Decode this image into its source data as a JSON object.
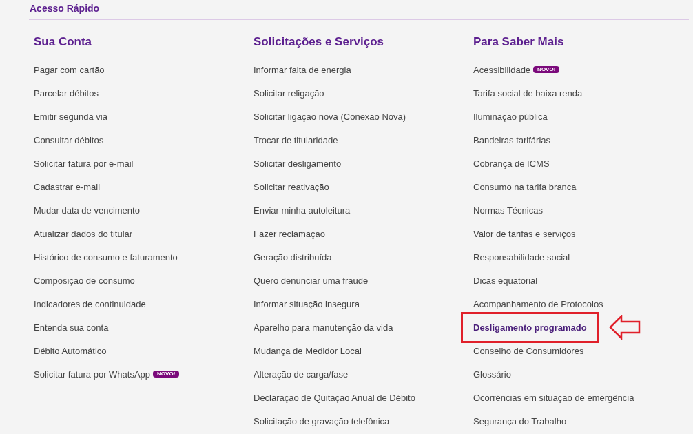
{
  "section_title": "Acesso Rápido",
  "columns": [
    {
      "heading": "Sua Conta",
      "items": [
        {
          "label": "Pagar com cartão",
          "highlighted": false
        },
        {
          "label": "Parcelar débitos",
          "highlighted": false
        },
        {
          "label": "Emitir segunda via",
          "highlighted": false
        },
        {
          "label": "Consultar débitos",
          "highlighted": false
        },
        {
          "label": "Solicitar fatura por e-mail",
          "highlighted": false
        },
        {
          "label": "Cadastrar e-mail",
          "highlighted": false
        },
        {
          "label": "Mudar data de vencimento",
          "highlighted": false
        },
        {
          "label": "Atualizar dados do titular",
          "highlighted": false
        },
        {
          "label": "Histórico de consumo e faturamento",
          "highlighted": false
        },
        {
          "label": "Composição de consumo",
          "highlighted": false
        },
        {
          "label": "Indicadores de continuidade",
          "highlighted": false
        },
        {
          "label": "Entenda sua conta",
          "highlighted": false
        },
        {
          "label": "Débito Automático",
          "highlighted": false
        },
        {
          "label": "Solicitar fatura por WhatsApp",
          "badge": "NOVO!",
          "highlighted": false
        }
      ]
    },
    {
      "heading": "Solicitações e Serviços",
      "items": [
        {
          "label": "Informar falta de energia",
          "highlighted": false
        },
        {
          "label": "Solicitar religação",
          "highlighted": false
        },
        {
          "label": "Solicitar ligação nova (Conexão Nova)",
          "highlighted": false
        },
        {
          "label": "Trocar de titularidade",
          "highlighted": false
        },
        {
          "label": "Solicitar desligamento",
          "highlighted": false
        },
        {
          "label": "Solicitar reativação",
          "highlighted": false
        },
        {
          "label": "Enviar minha autoleitura",
          "highlighted": false
        },
        {
          "label": "Fazer reclamação",
          "highlighted": false
        },
        {
          "label": "Geração distribuída",
          "highlighted": false
        },
        {
          "label": "Quero denunciar uma fraude",
          "highlighted": false
        },
        {
          "label": "Informar situação insegura",
          "highlighted": false
        },
        {
          "label": "Aparelho para manutenção da vida",
          "highlighted": false
        },
        {
          "label": "Mudança de Medidor Local",
          "highlighted": false
        },
        {
          "label": "Alteração de carga/fase",
          "highlighted": false
        },
        {
          "label": "Declaração de Quitação Anual de Débito",
          "highlighted": false
        },
        {
          "label": "Solicitação de gravação telefônica",
          "highlighted": false
        }
      ]
    },
    {
      "heading": "Para Saber Mais",
      "items": [
        {
          "label": "Acessibilidade",
          "badge": "NOVO!",
          "highlighted": false
        },
        {
          "label": "Tarifa social de baixa renda",
          "highlighted": false
        },
        {
          "label": "Iluminação pública",
          "highlighted": false
        },
        {
          "label": "Bandeiras tarifárias",
          "highlighted": false
        },
        {
          "label": "Cobrança de ICMS",
          "highlighted": false
        },
        {
          "label": "Consumo na tarifa branca",
          "highlighted": false
        },
        {
          "label": "Normas Técnicas",
          "highlighted": false
        },
        {
          "label": "Valor de tarifas e serviços",
          "highlighted": false
        },
        {
          "label": "Responsabilidade social",
          "highlighted": false
        },
        {
          "label": "Dicas equatorial",
          "highlighted": false
        },
        {
          "label": "Acompanhamento de Protocolos",
          "highlighted": false
        },
        {
          "label": "Desligamento programado",
          "highlighted": true
        },
        {
          "label": "Conselho de Consumidores",
          "highlighted": false
        },
        {
          "label": "Glossário",
          "highlighted": false
        },
        {
          "label": "Ocorrências em situação de emergência",
          "highlighted": false
        },
        {
          "label": "Segurança do Trabalho",
          "highlighted": false
        }
      ]
    }
  ]
}
